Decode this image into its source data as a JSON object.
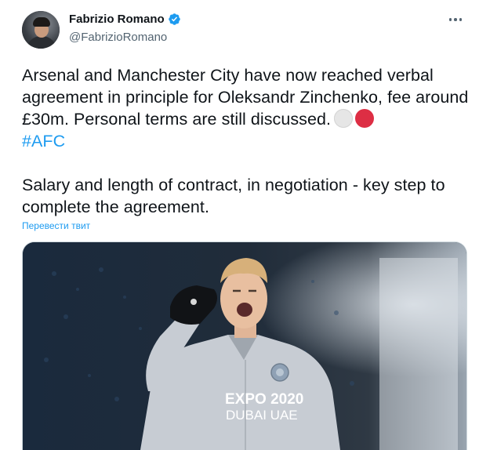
{
  "tweet": {
    "author": {
      "name": "Fabrizio Romano",
      "handle": "@FabrizioRomano",
      "verified": true,
      "verified_color": "#1d9bf0"
    },
    "text_line1_part1": "Arsenal and Manchester City have now reached verbal agreement in principle for Oleksandr Zinchenko, fee around £30m. Personal terms are still discussed.",
    "hashtag": "#AFC",
    "text_para2": "Salary and length of contract, in negotiation - key step to complete the agreement.",
    "emoji": [
      "white-circle",
      "red-circle"
    ],
    "translate_link": "Перевести твит",
    "media": {
      "description_icon": "photo-football-player",
      "shirt_text_line1": "EXPO 2020",
      "shirt_text_line2": "DUBAI UAE"
    }
  },
  "colors": {
    "link": "#1d9bf0",
    "text": "#0f1419",
    "secondary": "#536471"
  }
}
